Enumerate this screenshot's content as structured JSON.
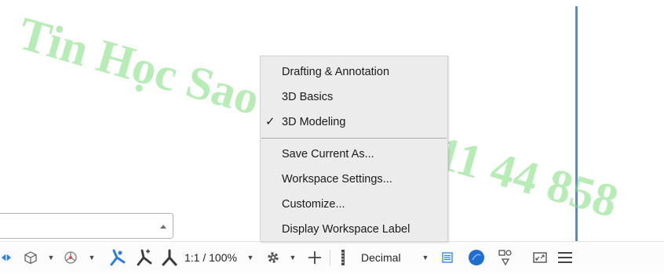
{
  "workspace_menu": {
    "items": [
      {
        "label": "Drafting & Annotation",
        "checked": false
      },
      {
        "label": "3D Basics",
        "checked": false
      },
      {
        "label": "3D Modeling",
        "checked": true
      },
      {
        "label": "Save Current As...",
        "checked": false
      },
      {
        "label": "Workspace Settings...",
        "checked": false
      },
      {
        "label": "Customize...",
        "checked": false
      },
      {
        "label": "Display Workspace Label",
        "checked": false
      }
    ],
    "check_glyph": "✓"
  },
  "statusbar": {
    "annotation_scale": "1:1 / 100%",
    "units": "Decimal"
  },
  "watermark": {
    "text": "Tin Học Sao Việt 093 11 44 858"
  },
  "colors": {
    "accent_blue": "#2b7de0",
    "watermark_green": "#7bdc7b"
  }
}
